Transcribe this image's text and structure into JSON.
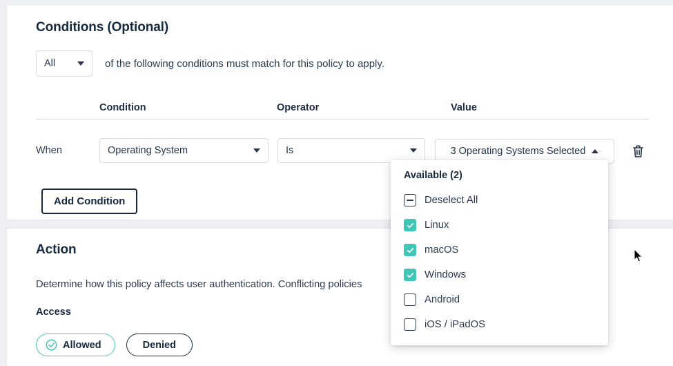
{
  "conditions": {
    "title": "Conditions (Optional)",
    "match_select": {
      "value": "All",
      "icon": "chevron-down-icon"
    },
    "match_sentence": "of the following conditions must match for this policy to apply.",
    "columns": {
      "condition": "Condition",
      "operator": "Operator",
      "value": "Value"
    },
    "row": {
      "when_label": "When",
      "condition_value": "Operating System",
      "operator_value": "Is",
      "value_button": "3 Operating Systems Selected",
      "value_button_icon": "chevron-up-icon",
      "delete_icon": "trash-icon"
    },
    "add_button": "Add Condition"
  },
  "value_dropdown": {
    "header": "Available (2)",
    "items": [
      {
        "label": "Deselect All",
        "state": "indeterminate"
      },
      {
        "label": "Linux",
        "state": "checked"
      },
      {
        "label": "macOS",
        "state": "checked"
      },
      {
        "label": "Windows",
        "state": "checked"
      },
      {
        "label": "Android",
        "state": "unchecked"
      },
      {
        "label": "iOS / iPadOS",
        "state": "unchecked"
      }
    ]
  },
  "action": {
    "title": "Action",
    "description": "Determine how this policy affects user authentication. Conflicting policies",
    "access_label": "Access",
    "options": [
      {
        "label": "Allowed",
        "selected": true,
        "icon": "check-circle-icon"
      },
      {
        "label": "Denied",
        "selected": false
      }
    ]
  },
  "colors": {
    "accent_teal": "#3fc6b7",
    "ink": "#14293f",
    "page_bg": "#edeff2",
    "border": "#d8dce2"
  },
  "cursor": {
    "icon": "arrow-pointer-icon"
  }
}
